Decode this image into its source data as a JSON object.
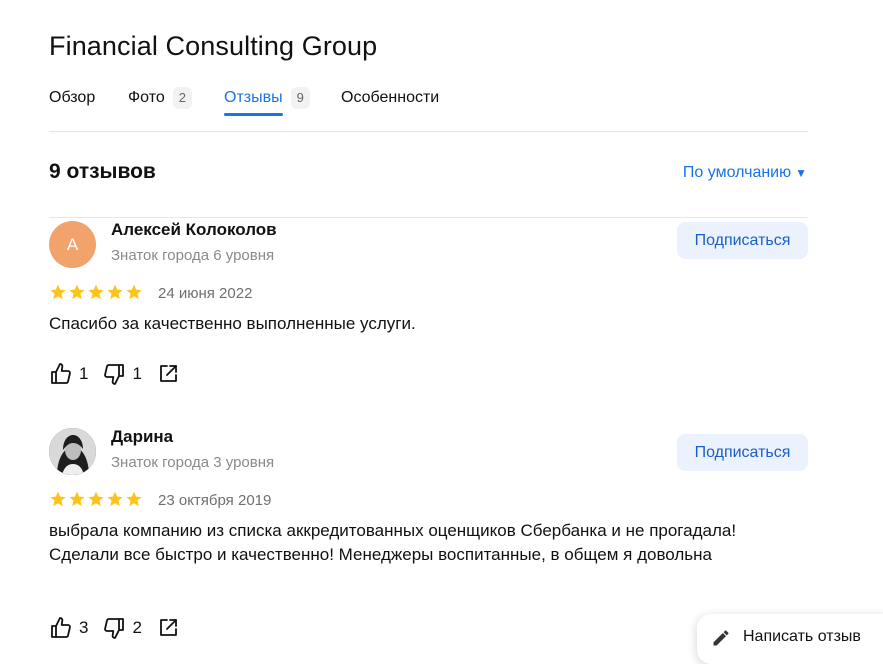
{
  "org": {
    "title": "Financial Consulting Group"
  },
  "tabs": [
    {
      "label": "Обзор",
      "count": null,
      "active": false
    },
    {
      "label": "Фото",
      "count": "2",
      "active": false
    },
    {
      "label": "Отзывы",
      "count": "9",
      "active": true
    },
    {
      "label": "Особенности",
      "count": null,
      "active": false
    }
  ],
  "reviews_header": {
    "count_label": "9 отзывов",
    "sort_label": "По умолчанию",
    "sort_icon": "caret-down-icon"
  },
  "reviews": [
    {
      "author": "Алексей Колоколов",
      "avatar_letter": "А",
      "level": "Знаток города 6 уровня",
      "subscribe_label": "Подписаться",
      "rating": 5,
      "date": "24 июня 2022",
      "text": "Спасибо за качественно выполненные услуги.",
      "likes": "1",
      "dislikes": "1"
    },
    {
      "author": "Дарина",
      "avatar_letter": "",
      "level": "Знаток города 3 уровня",
      "subscribe_label": "Подписаться",
      "rating": 5,
      "date": "23 октября 2019",
      "text": "выбрала компанию из списка аккредитованных оценщиков Сбербанка и не прогадала! Сделали все быстро и качественно! Менеджеры воспитанные, в общем я довольна",
      "likes": "3",
      "dislikes": "2"
    }
  ],
  "write_review": {
    "label": "Написать отзыв",
    "icon": "pencil-icon"
  },
  "colors": {
    "accent": "#1a73e8",
    "star": "#fcc419",
    "avatar_letter_bg": "#f2a36b",
    "subscribe_bg": "#ecf2fd"
  }
}
